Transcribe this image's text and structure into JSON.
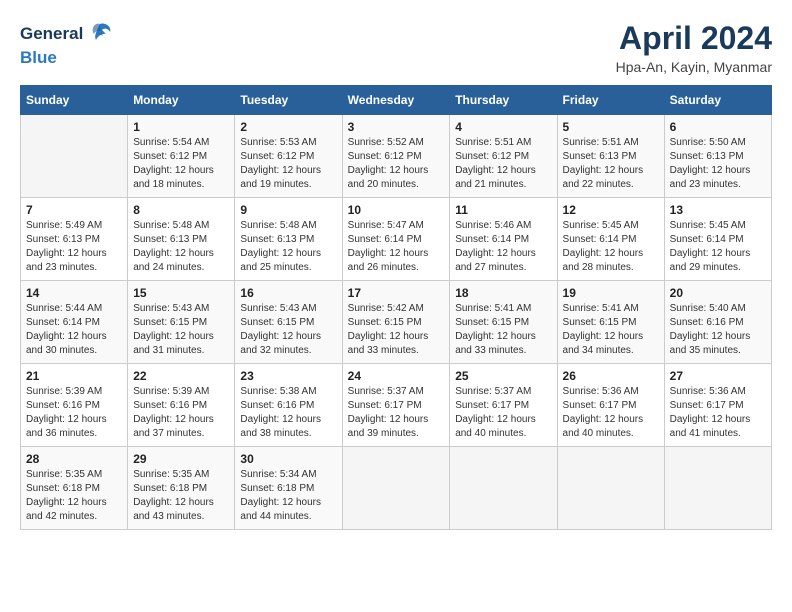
{
  "header": {
    "logo_general": "General",
    "logo_blue": "Blue",
    "title": "April 2024",
    "subtitle": "Hpa-An, Kayin, Myanmar"
  },
  "calendar": {
    "days_of_week": [
      "Sunday",
      "Monday",
      "Tuesday",
      "Wednesday",
      "Thursday",
      "Friday",
      "Saturday"
    ],
    "weeks": [
      [
        {
          "day": "",
          "info": ""
        },
        {
          "day": "1",
          "info": "Sunrise: 5:54 AM\nSunset: 6:12 PM\nDaylight: 12 hours\nand 18 minutes."
        },
        {
          "day": "2",
          "info": "Sunrise: 5:53 AM\nSunset: 6:12 PM\nDaylight: 12 hours\nand 19 minutes."
        },
        {
          "day": "3",
          "info": "Sunrise: 5:52 AM\nSunset: 6:12 PM\nDaylight: 12 hours\nand 20 minutes."
        },
        {
          "day": "4",
          "info": "Sunrise: 5:51 AM\nSunset: 6:12 PM\nDaylight: 12 hours\nand 21 minutes."
        },
        {
          "day": "5",
          "info": "Sunrise: 5:51 AM\nSunset: 6:13 PM\nDaylight: 12 hours\nand 22 minutes."
        },
        {
          "day": "6",
          "info": "Sunrise: 5:50 AM\nSunset: 6:13 PM\nDaylight: 12 hours\nand 23 minutes."
        }
      ],
      [
        {
          "day": "7",
          "info": "Sunrise: 5:49 AM\nSunset: 6:13 PM\nDaylight: 12 hours\nand 23 minutes."
        },
        {
          "day": "8",
          "info": "Sunrise: 5:48 AM\nSunset: 6:13 PM\nDaylight: 12 hours\nand 24 minutes."
        },
        {
          "day": "9",
          "info": "Sunrise: 5:48 AM\nSunset: 6:13 PM\nDaylight: 12 hours\nand 25 minutes."
        },
        {
          "day": "10",
          "info": "Sunrise: 5:47 AM\nSunset: 6:14 PM\nDaylight: 12 hours\nand 26 minutes."
        },
        {
          "day": "11",
          "info": "Sunrise: 5:46 AM\nSunset: 6:14 PM\nDaylight: 12 hours\nand 27 minutes."
        },
        {
          "day": "12",
          "info": "Sunrise: 5:45 AM\nSunset: 6:14 PM\nDaylight: 12 hours\nand 28 minutes."
        },
        {
          "day": "13",
          "info": "Sunrise: 5:45 AM\nSunset: 6:14 PM\nDaylight: 12 hours\nand 29 minutes."
        }
      ],
      [
        {
          "day": "14",
          "info": "Sunrise: 5:44 AM\nSunset: 6:14 PM\nDaylight: 12 hours\nand 30 minutes."
        },
        {
          "day": "15",
          "info": "Sunrise: 5:43 AM\nSunset: 6:15 PM\nDaylight: 12 hours\nand 31 minutes."
        },
        {
          "day": "16",
          "info": "Sunrise: 5:43 AM\nSunset: 6:15 PM\nDaylight: 12 hours\nand 32 minutes."
        },
        {
          "day": "17",
          "info": "Sunrise: 5:42 AM\nSunset: 6:15 PM\nDaylight: 12 hours\nand 33 minutes."
        },
        {
          "day": "18",
          "info": "Sunrise: 5:41 AM\nSunset: 6:15 PM\nDaylight: 12 hours\nand 33 minutes."
        },
        {
          "day": "19",
          "info": "Sunrise: 5:41 AM\nSunset: 6:15 PM\nDaylight: 12 hours\nand 34 minutes."
        },
        {
          "day": "20",
          "info": "Sunrise: 5:40 AM\nSunset: 6:16 PM\nDaylight: 12 hours\nand 35 minutes."
        }
      ],
      [
        {
          "day": "21",
          "info": "Sunrise: 5:39 AM\nSunset: 6:16 PM\nDaylight: 12 hours\nand 36 minutes."
        },
        {
          "day": "22",
          "info": "Sunrise: 5:39 AM\nSunset: 6:16 PM\nDaylight: 12 hours\nand 37 minutes."
        },
        {
          "day": "23",
          "info": "Sunrise: 5:38 AM\nSunset: 6:16 PM\nDaylight: 12 hours\nand 38 minutes."
        },
        {
          "day": "24",
          "info": "Sunrise: 5:37 AM\nSunset: 6:17 PM\nDaylight: 12 hours\nand 39 minutes."
        },
        {
          "day": "25",
          "info": "Sunrise: 5:37 AM\nSunset: 6:17 PM\nDaylight: 12 hours\nand 40 minutes."
        },
        {
          "day": "26",
          "info": "Sunrise: 5:36 AM\nSunset: 6:17 PM\nDaylight: 12 hours\nand 40 minutes."
        },
        {
          "day": "27",
          "info": "Sunrise: 5:36 AM\nSunset: 6:17 PM\nDaylight: 12 hours\nand 41 minutes."
        }
      ],
      [
        {
          "day": "28",
          "info": "Sunrise: 5:35 AM\nSunset: 6:18 PM\nDaylight: 12 hours\nand 42 minutes."
        },
        {
          "day": "29",
          "info": "Sunrise: 5:35 AM\nSunset: 6:18 PM\nDaylight: 12 hours\nand 43 minutes."
        },
        {
          "day": "30",
          "info": "Sunrise: 5:34 AM\nSunset: 6:18 PM\nDaylight: 12 hours\nand 44 minutes."
        },
        {
          "day": "",
          "info": ""
        },
        {
          "day": "",
          "info": ""
        },
        {
          "day": "",
          "info": ""
        },
        {
          "day": "",
          "info": ""
        }
      ]
    ]
  }
}
